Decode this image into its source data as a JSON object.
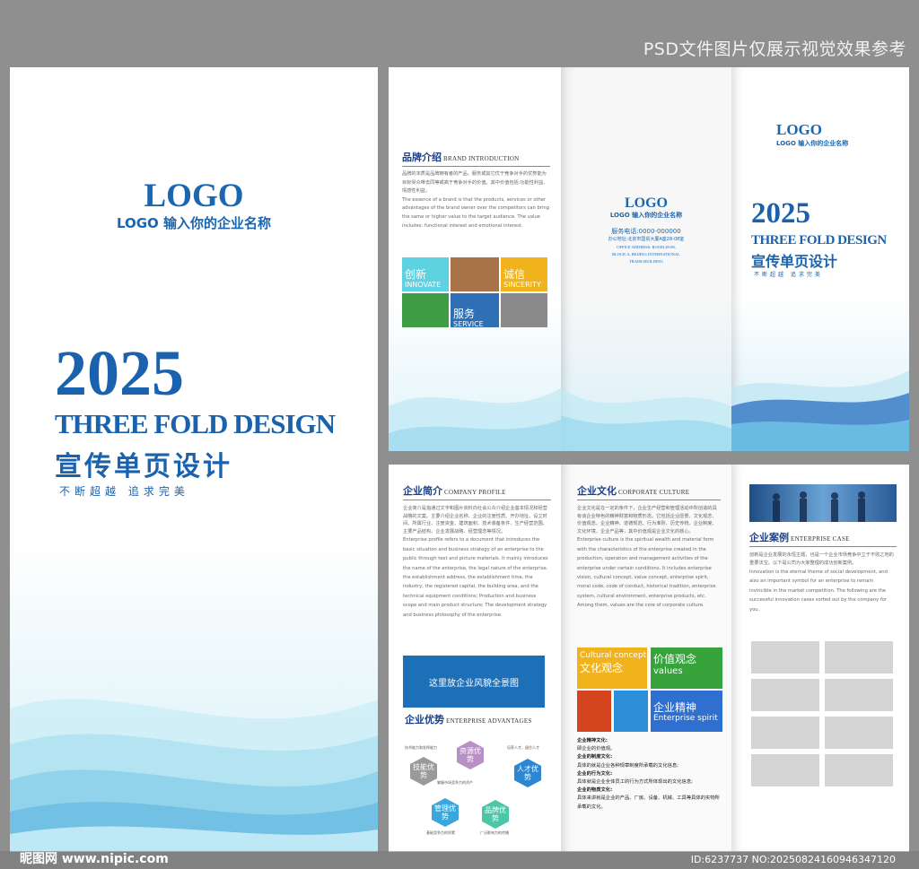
{
  "top_note": "PSD文件图片仅展示视觉效果参考",
  "cover": {
    "logo": "LOGO",
    "logo_sub": "LOGO 输入你的企业名称",
    "year": "2025",
    "title_en": "THREE FOLD DESIGN",
    "title_cn": "宣传单页设计",
    "slogan": "不断超越 追求完美"
  },
  "brand": {
    "title": "品牌介绍",
    "title_en": "BRAND INTRODUCTION",
    "p1": "品牌的本质是品牌拥有者的产品、服务或其它优于竞争对手的优势能为目标受众带去同等或高于竞争对手的价值。其中价值包括:功能性利益、情感性利益。",
    "p2": "The essence of a brand is that the products, services or other advantages of the brand owner over the competitors can bring the same or higher value to the target audience. The value includes: functional interest and emotional interest.",
    "tiles": [
      {
        "cn": "创新",
        "en": "INNOVATE"
      },
      {
        "cn": "诚信",
        "en": "SINCERITY"
      },
      {
        "cn": "服务",
        "en": "SERVICE"
      }
    ]
  },
  "middle_back": {
    "logo": "LOGO",
    "logo_sub": "LOGO 输入你的企业名称",
    "phone": "服务电话:0000-000000",
    "address": "办公地址:北京市国贸大厦A座28-08室",
    "address_en1": "OFFICE ADDRESS: ROOM 28-08,",
    "address_en2": "BLOCK A, BEIJING INTERNATIONAL",
    "address_en3": "TRADE BUILDING"
  },
  "right_front": {
    "logo": "LOGO",
    "logo_sub": "LOGO 输入你的企业名称",
    "year": "2025",
    "title_en": "THREE FOLD DESIGN",
    "title_cn": "宣传单页设计",
    "slogan": "不断超越 追求完美"
  },
  "profile": {
    "title": "企业简介",
    "title_en": "COMPANY PROFILE",
    "p1": "企业简介是指通过文字和图片资料向社会公众介绍企业基本情况和经营战略的文案。主要介绍企业名称、企业的注册性质、开办地址、设立时间、所属行业、注册资金、建筑面积、技术装备条件、生产经营范围、主要产品结构、企业发展战略、经营理念等情况。",
    "p2": "Enterprise profile refers to a document that introduces the basic situation and business strategy of an enterprise to the public through text and picture materials. It mainly introduces the name of the enterprise, the legal nature of the enterprise, the establishment address, the establishment time, the industry, the registered capital, the building area, and the technical equipment conditions; Production and business scope and main product structure; The development strategy and business philosophy of the enterprise.",
    "image_label": "这里放企业风貌全景图"
  },
  "advantages": {
    "title": "企业优势",
    "title_en": "ENTERPRISE ADVANTAGES",
    "hexes": [
      "技能优势",
      "资源优势",
      "人才优势",
      "管理优势",
      "品牌优势"
    ],
    "notes": [
      "技术能力和发挥能力",
      "培养人才，留住人才",
      "掌握市场竞争力的资产",
      "基础竞争力的积累",
      "广泛影响力的传播"
    ]
  },
  "culture": {
    "title": "企业文化",
    "title_en": "CORPORATE CULTURE",
    "p1": "企业文化是在一定的条件下，企业生产经营和管理活动中所创造的具有该企业特色的精神财富和物质形态。它包括企业愿景、文化观念、价值观念、企业精神、道德规范、行为准则、历史传统、企业制度、文化环境、企业产品等，其中价值观是企业文化的核心。",
    "p2": "Enterprise culture is the spiritual wealth and material form with the characteristics of the enterprise created in the production, operation and management activities of the enterprise under certain conditions. It includes enterprise vision, cultural concept, value concept, enterprise spirit, moral code, code of conduct, historical tradition, enterprise system, cultural environment, enterprise products, etc. Among them, values are the core of corporate culture.",
    "tiles": [
      {
        "a": "Cultural concept",
        "b": "文化观念"
      },
      {
        "a": "价值观念",
        "b": "values"
      },
      {
        "a": "企业精神",
        "b": "Enterprise spirit"
      }
    ],
    "list": [
      {
        "h": "企业精神文化:",
        "t": "即企业的价值观。"
      },
      {
        "h": "企业的制度文化:",
        "t": "具体的就是企业各种规章制度所承载的文化信息;"
      },
      {
        "h": "企业的行为文化:",
        "t": "具体就是企业全体员工的行为方式所体现出的文化信息;"
      },
      {
        "h": "企业的物质文化:",
        "t": "具体来讲就是企业的产品、厂房、设备、机械、工具等具体的实物所承载的文化。"
      }
    ]
  },
  "cases": {
    "title": "企业案例",
    "title_en": "ENTERPRISE CASE",
    "p1": "创新是企业发展的永恒主题，也是一个企业市场竞争中立于不败之地的重要法宝。以下是公司为大家整理的成功创新案例。",
    "p2": "Innovation is the eternal theme of social development, and also an important symbol for an enterprise to remain invincible in the market competition. The following are the successful innovation cases sorted out by the company for you."
  },
  "watermark": {
    "left": "昵图网 www.nipic.com",
    "right": "ID:6237737 NO:20250824160946347120"
  },
  "colors": {
    "brand_blue": "#1a62ad",
    "navy": "#1a3f87",
    "tile_blue": "#1d6fb8"
  }
}
